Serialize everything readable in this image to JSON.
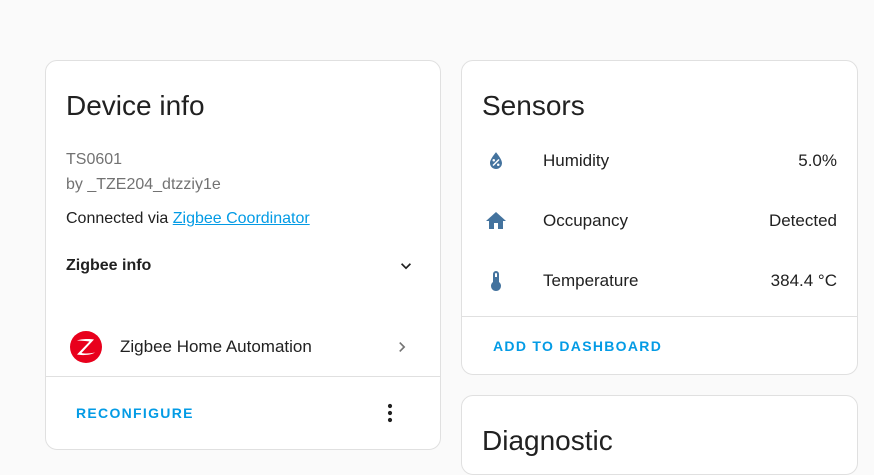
{
  "device_info": {
    "title": "Device info",
    "model": "TS0601",
    "manufacturer": "by _TZE204_dtzziy1e",
    "connected_prefix": "Connected via ",
    "connected_link": "Zigbee Coordinator",
    "zigbee_info_label": "Zigbee info",
    "integration_label": "Zigbee Home Automation",
    "reconfigure_label": "RECONFIGURE"
  },
  "sensors": {
    "title": "Sensors",
    "items": [
      {
        "name": "Humidity",
        "value": "5.0%",
        "icon": "water-percent-icon"
      },
      {
        "name": "Occupancy",
        "value": "Detected",
        "icon": "home-icon"
      },
      {
        "name": "Temperature",
        "value": "384.4 °C",
        "icon": "thermometer-icon"
      }
    ],
    "add_to_dashboard_label": "ADD TO DASHBOARD"
  },
  "diagnostic": {
    "title": "Diagnostic"
  },
  "colors": {
    "accent": "#039be5",
    "icon": "#44739e",
    "zigbee_brand": "#e8001c"
  }
}
